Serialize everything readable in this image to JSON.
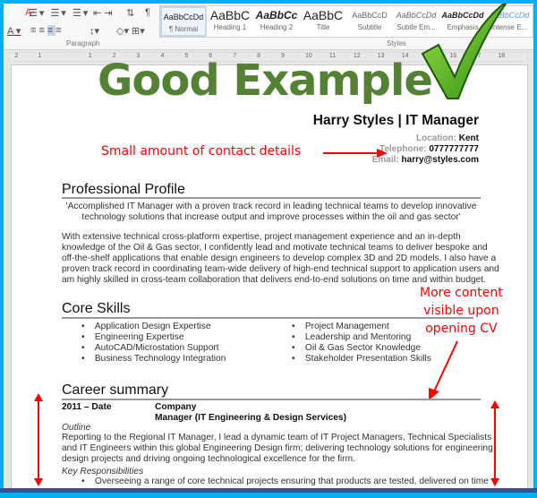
{
  "ribbon": {
    "styles": [
      {
        "preview": "AaBbCcDd",
        "label": "¶ Normal"
      },
      {
        "preview": "AaBbC",
        "label": "Heading 1"
      },
      {
        "preview": "AaBbCc",
        "label": "Heading 2"
      },
      {
        "preview": "AaBbC",
        "label": "Title"
      },
      {
        "preview": "AaBbCcD",
        "label": "Subtitle"
      },
      {
        "preview": "AaBbCcDd",
        "label": "Subtle Em..."
      },
      {
        "preview": "AaBbCcDd",
        "label": "Emphasis"
      },
      {
        "preview": "AaBbCcDd",
        "label": "Intense E..."
      }
    ],
    "paragraph_label": "Paragraph",
    "styles_label": "Styles",
    "ruler_ticks": [
      "2",
      "1",
      "1",
      "2",
      "3",
      "4",
      "5",
      "6",
      "7",
      "8",
      "9",
      "10",
      "11",
      "12",
      "13",
      "14",
      "15",
      "16",
      "17",
      "18"
    ]
  },
  "overlay": {
    "headline": "Good Example",
    "headline_color": "#548235",
    "contact_note": "Small amount of contact details",
    "content_note": [
      "More content",
      "visible upon",
      "opening CV"
    ],
    "annotation_color": "#ff0000"
  },
  "cv": {
    "name": "Harry Styles | IT Manager",
    "contact": [
      {
        "label": "Location:",
        "value": "Kent"
      },
      {
        "label": "Telephone:",
        "value": "0777777777"
      },
      {
        "label": "Email:",
        "value": "harry@styles.com"
      }
    ],
    "profile_heading": "Professional Profile",
    "quote": [
      "'Accomplished IT Manager with a proven track record in leading technical teams to develop innovative",
      "technology solutions that increase output and improve processes within the oil and gas sector'"
    ],
    "profile_text": [
      "With extensive technical cross-platform expertise, project management experience and an in-depth",
      "knowledge of the Oil & Gas sector, I confidently lead and motivate technical teams to deliver bespoke and",
      "off-the-shelf applications that enable design engineers to develop complex 3D and 2D models.  I also have a",
      "proven track record in coordinating team-wide delivery of high-end technical support to application users and",
      "am highly skilled in cross-team collaboration that delivers end-to-end solutions on time and within budget."
    ],
    "skills_heading": "Core Skills",
    "skills_left": [
      "Application Design Expertise",
      "Engineering Expertise",
      "AutoCAD/Microstation Support",
      "Business Technology Integration"
    ],
    "skills_right": [
      "Project Management",
      "Leadership and Mentoring",
      "Oil & Gas Sector Knowledge",
      "Stakeholder Presentation Skills"
    ],
    "career_heading": "Career summary",
    "job": {
      "dates": "2011 – Date",
      "company": "Company",
      "title": "Manager (IT Engineering & Design Services)",
      "outline_label": "Outline",
      "outline": [
        "Reporting to the Regional IT Manager, I lead a dynamic team of IT Project Managers, Technical Specialists",
        "and IT Engineers within this global Engineering Design firm; delivering technology solutions for engineering",
        "design projects and driving ongoing technological excellence for the firm."
      ],
      "resp_label": "Key Responsibilities",
      "resp": [
        "Overseeing a range of core technical projects ensuring that products are tested, delivered on time"
      ]
    }
  }
}
